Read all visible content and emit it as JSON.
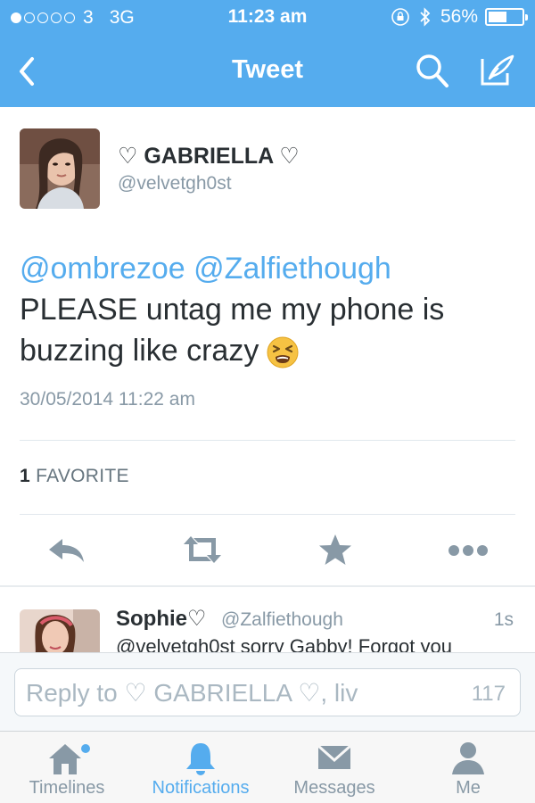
{
  "status_bar": {
    "carrier": "3",
    "network": "3G",
    "time": "11:23 am",
    "battery": "56%",
    "battery_level": 0.56
  },
  "nav": {
    "title": "Tweet",
    "icons": [
      "back-chevron-icon",
      "search-icon",
      "compose-tweet-icon"
    ]
  },
  "tweet": {
    "author_name": "♡ GABRIELLA ♡",
    "author_handle": "@velvetgh0st",
    "mention1": "@ombrezoe",
    "mention2": "@Zalfiethough",
    "text": "PLEASE untag me my phone is buzzing like crazy",
    "emoji": "tired-face-emoji",
    "timestamp": "30/05/2014 11:22 am",
    "favorite_count": "1",
    "favorite_label": "FAVORITE"
  },
  "reply_preview": {
    "name": "Sophie♡",
    "handle": "@Zalfiethough",
    "time": "1s",
    "text": "@velvetgh0st sorry Gabby! Forgot you"
  },
  "reply_bar": {
    "placeholder": "Reply to ♡ GABRIELLA ♡, liv",
    "char_count": "117"
  },
  "tabs": [
    {
      "label": "Timelines"
    },
    {
      "label": "Notifications"
    },
    {
      "label": "Messages"
    },
    {
      "label": "Me"
    }
  ],
  "colors": {
    "brand_blue": "#55acee",
    "text": "#292f33",
    "muted": "#8899a6",
    "action_icon": "#8899a6"
  }
}
